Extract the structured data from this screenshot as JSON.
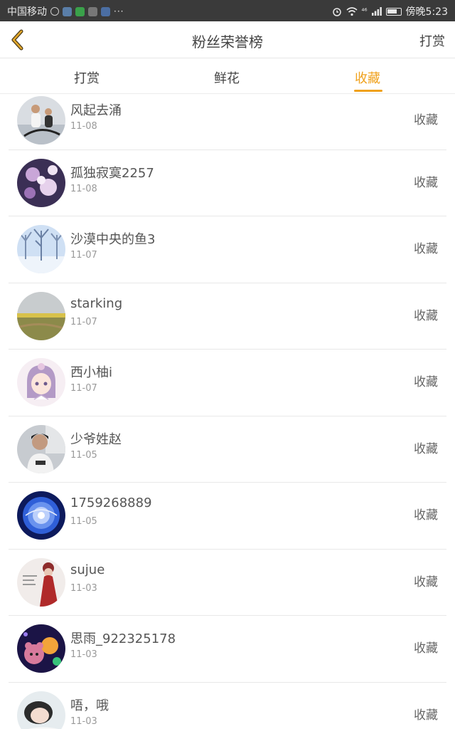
{
  "status_bar": {
    "carrier": "中国移动",
    "dots": "···",
    "time": "傍晚5:23",
    "signal_text": "⁴⁶"
  },
  "header": {
    "title": "粉丝荣誉榜",
    "action_label": "打赏"
  },
  "tabs": [
    {
      "label": "打赏"
    },
    {
      "label": "鲜花"
    },
    {
      "label": "收藏"
    }
  ],
  "active_tab": "收藏",
  "accent_color": "#f0a11c",
  "fans": [
    {
      "name": "风起去涌",
      "date": "11-08",
      "action": "收藏",
      "avatar_theme": "running-couple"
    },
    {
      "name": "孤独寂寞2257",
      "date": "11-08",
      "action": "收藏",
      "avatar_theme": "purple-anime-flowers"
    },
    {
      "name": "沙漠中央的鱼3",
      "date": "11-07",
      "action": "收藏",
      "avatar_theme": "snowy-trees"
    },
    {
      "name": "starking",
      "date": "11-07",
      "action": "收藏",
      "avatar_theme": "field-landscape"
    },
    {
      "name": "西小柚i",
      "date": "11-07",
      "action": "收藏",
      "avatar_theme": "anime-girl"
    },
    {
      "name": "少爷姓赵",
      "date": "11-05",
      "action": "收藏",
      "avatar_theme": "boy-photo"
    },
    {
      "name": "1759268889",
      "date": "11-05",
      "action": "收藏",
      "avatar_theme": "blue-flower"
    },
    {
      "name": "sujue",
      "date": "11-03",
      "action": "收藏",
      "avatar_theme": "red-figure"
    },
    {
      "name": "思雨_922325178",
      "date": "11-03",
      "action": "收藏",
      "avatar_theme": "colorful-bears"
    },
    {
      "name": "唔，哦",
      "date": "11-03",
      "action": "收藏",
      "avatar_theme": "sleeping-girl"
    }
  ]
}
